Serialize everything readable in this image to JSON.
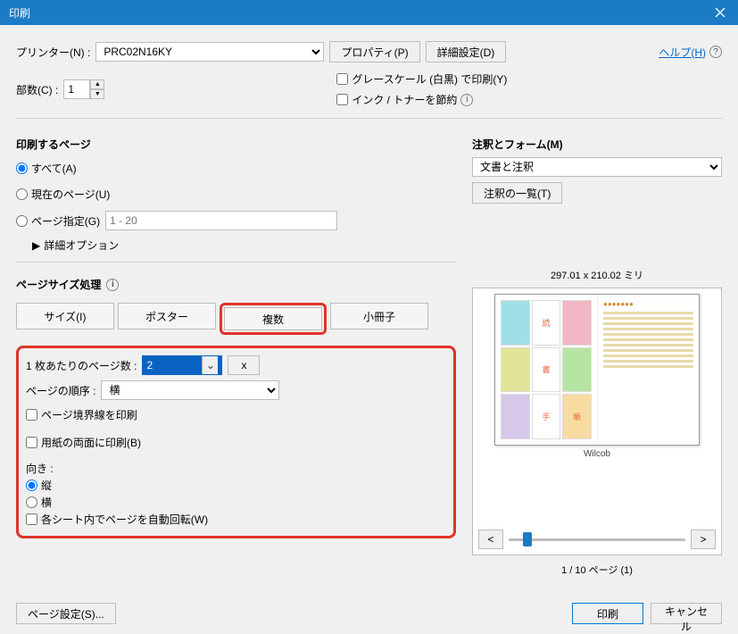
{
  "title": "印刷",
  "help_link": "ヘルプ(H)",
  "printer": {
    "label": "プリンター(N) :",
    "value": "PRC02N16KY",
    "properties_btn": "プロパティ(P)",
    "advanced_btn": "詳細設定(D)"
  },
  "copies": {
    "label": "部数(C) :",
    "value": "1"
  },
  "grayscale_label": "グレースケール (白黒) で印刷(Y)",
  "save_ink_label": "インク / トナーを節約",
  "pages": {
    "title": "印刷するページ",
    "all": "すべて(A)",
    "current": "現在のページ(U)",
    "range": "ページ指定(G)",
    "range_placeholder": "1 - 20",
    "more": "詳細オプション"
  },
  "pagesize": {
    "title": "ページサイズ処理",
    "tabs": {
      "size": "サイズ(I)",
      "poster": "ポスター",
      "multi": "複数",
      "booklet": "小冊子"
    }
  },
  "multi": {
    "pps_label": "1 枚あたりのページ数 :",
    "pps_value": "2",
    "x": "x",
    "order_label": "ページの順序 :",
    "order_value": "横",
    "border": "ページ境界線を印刷",
    "duplex": "用紙の両面に印刷(B)",
    "orient_label": "向き :",
    "portrait": "縦",
    "landscape": "横",
    "autorotate": "各シート内でページを自動回転(W)"
  },
  "comments": {
    "title": "注釈とフォーム(M)",
    "value": "文書と注釈",
    "list_btn": "注釈の一覧(T)"
  },
  "preview": {
    "size": "297.01 x 210.02 ミリ",
    "caption": "Wilcob",
    "page_info": "1 / 10 ページ (1)",
    "cells": [
      "読",
      "書",
      "手",
      "帳"
    ],
    "nav_prev": "<",
    "nav_next": ">"
  },
  "footer": {
    "page_setup": "ページ設定(S)...",
    "print": "印刷",
    "cancel": "キャンセル"
  }
}
